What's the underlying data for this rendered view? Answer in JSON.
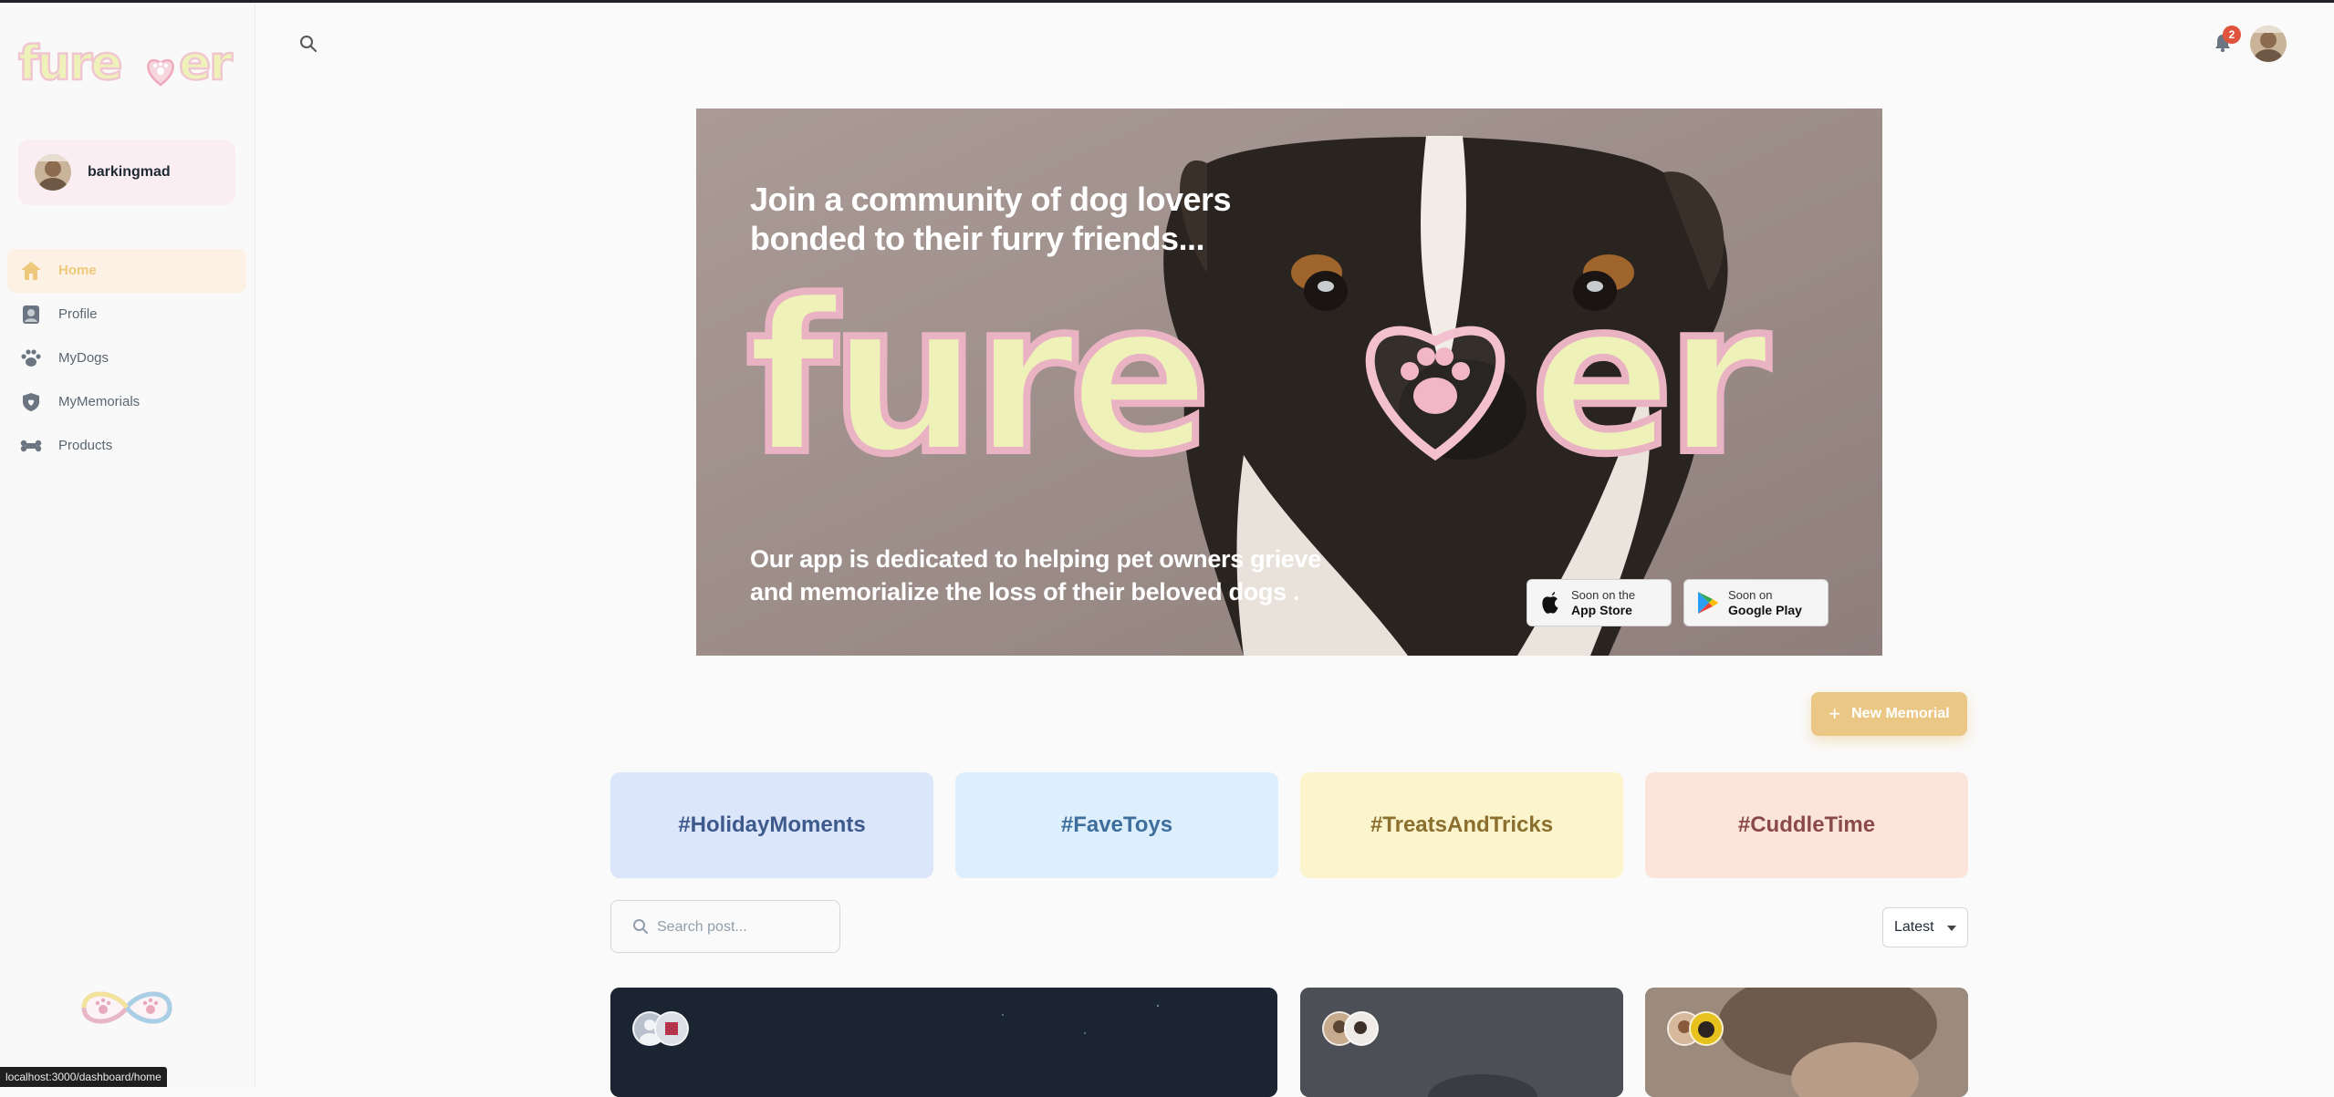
{
  "app": {
    "brand": "furever"
  },
  "account": {
    "username": "barkingmad"
  },
  "nav": {
    "items": [
      {
        "label": "Home",
        "icon": "home-icon",
        "active": true
      },
      {
        "label": "Profile",
        "icon": "profile-icon",
        "active": false
      },
      {
        "label": "MyDogs",
        "icon": "paw-icon",
        "active": false
      },
      {
        "label": "MyMemorials",
        "icon": "shield-heart-icon",
        "active": false
      },
      {
        "label": "Products",
        "icon": "bone-icon",
        "active": false
      }
    ]
  },
  "header": {
    "notification_count": "2"
  },
  "hero": {
    "title_line1": "Join a community of dog lovers",
    "title_line2": "bonded to their furry friends...",
    "brand": "furever",
    "subtitle_line1": "Our app is dedicated to helping pet owners grieve",
    "subtitle_line2": "and memorialize the loss of their beloved dogs .",
    "app_store": {
      "line1": "Soon on the",
      "line2": "App Store"
    },
    "google_play": {
      "line1": "Soon on",
      "line2": "Google Play"
    }
  },
  "actions": {
    "new_memorial": "New Memorial"
  },
  "tags": [
    {
      "label": "#HolidayMoments",
      "bg": "#dbe6fb",
      "color": "#3e5a8c"
    },
    {
      "label": "#FaveToys",
      "bg": "#ddeefc",
      "color": "#3e6f9c"
    },
    {
      "label": "#TreatsAndTricks",
      "bg": "#fcf4cd",
      "color": "#8a6f2f"
    },
    {
      "label": "#CuddleTime",
      "bg": "#fbe5da",
      "color": "#8a4a4a"
    }
  ],
  "search": {
    "placeholder": "Search post..."
  },
  "sort": {
    "selected": "Latest"
  },
  "status_bar": {
    "url": "localhost:3000/dashboard/home"
  },
  "colors": {
    "accent": "#ebc785",
    "active_nav": "#efc97b",
    "badge": "#e0533c"
  }
}
